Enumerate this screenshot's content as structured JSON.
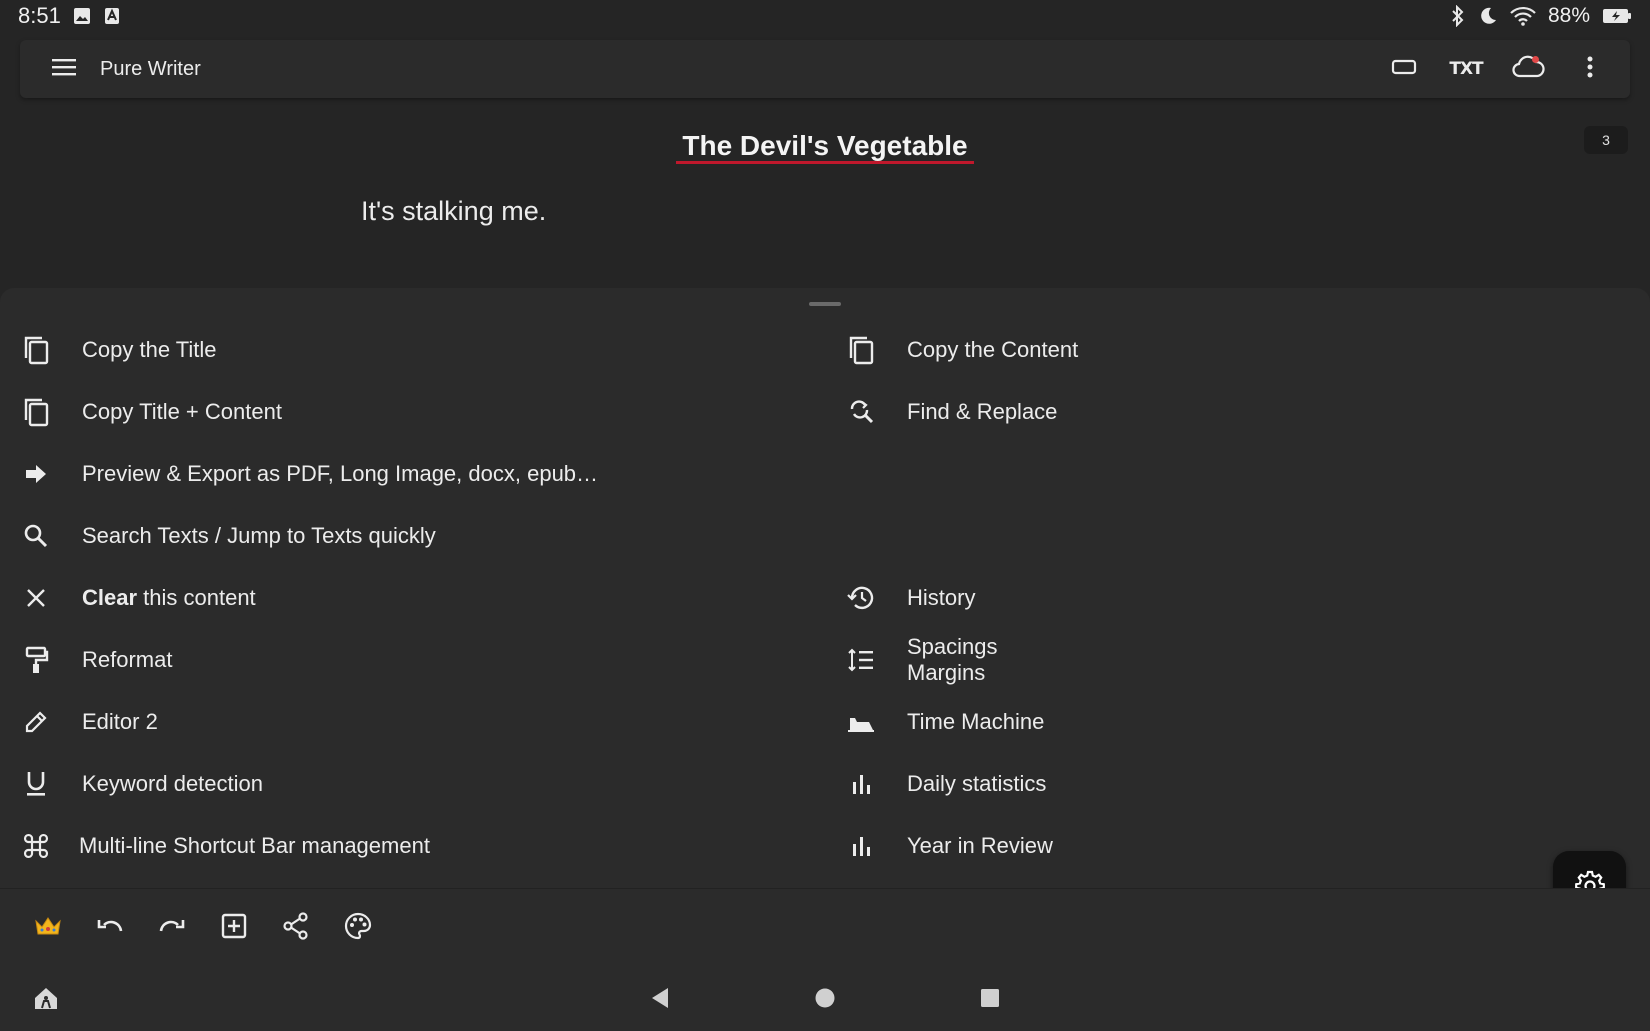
{
  "status_bar": {
    "time": "8:51",
    "battery": "88%"
  },
  "app_bar": {
    "title": "Pure Writer",
    "txt_label": "TXT"
  },
  "document": {
    "title": "The Devil's Vegetable",
    "body": "It's stalking me.",
    "page_count": "3"
  },
  "sheet": {
    "left_items": [
      {
        "label": "Copy the Title",
        "icon": "copy-icon"
      },
      {
        "label": "Copy Title + Content",
        "icon": "copy-icon"
      },
      {
        "label": "Preview & Export as PDF, Long Image, docx, epub…",
        "icon": "arrow-right-icon"
      },
      {
        "label": "Search Texts / Jump to Texts quickly",
        "icon": "search-icon"
      },
      {
        "label_bold": "Clear",
        "label_rest": " this content",
        "icon": "close-icon"
      },
      {
        "label": "Reformat",
        "icon": "paint-roller-icon"
      },
      {
        "label": "Editor 2",
        "icon": "pencil-icon"
      },
      {
        "label": "Keyword detection",
        "icon": "underline-icon"
      },
      {
        "label": "Multi-line Shortcut Bar management",
        "icon": "command-icon"
      }
    ],
    "right_items": [
      {
        "label": "Copy the Content",
        "icon": "copy-icon"
      },
      {
        "label": "Find & Replace",
        "icon": "find-replace-icon"
      },
      {
        "label": "History",
        "icon": "history-icon"
      },
      {
        "label_line1": "Spacings",
        "label_line2": "Margins",
        "icon": "line-spacing-icon"
      },
      {
        "label": "Time Machine",
        "icon": "time-machine-icon"
      },
      {
        "label": "Daily statistics",
        "icon": "bar-chart-icon"
      },
      {
        "label": "Year in Review",
        "icon": "bar-chart-icon"
      }
    ]
  },
  "toolbar": {
    "items": [
      "crown-icon",
      "undo-icon",
      "redo-icon",
      "add-box-icon",
      "share-icon",
      "palette-icon"
    ]
  },
  "colors": {
    "background": "#252525",
    "surface": "#2b2b2b",
    "accent_underline": "#c0182c",
    "fab": "#111111"
  }
}
